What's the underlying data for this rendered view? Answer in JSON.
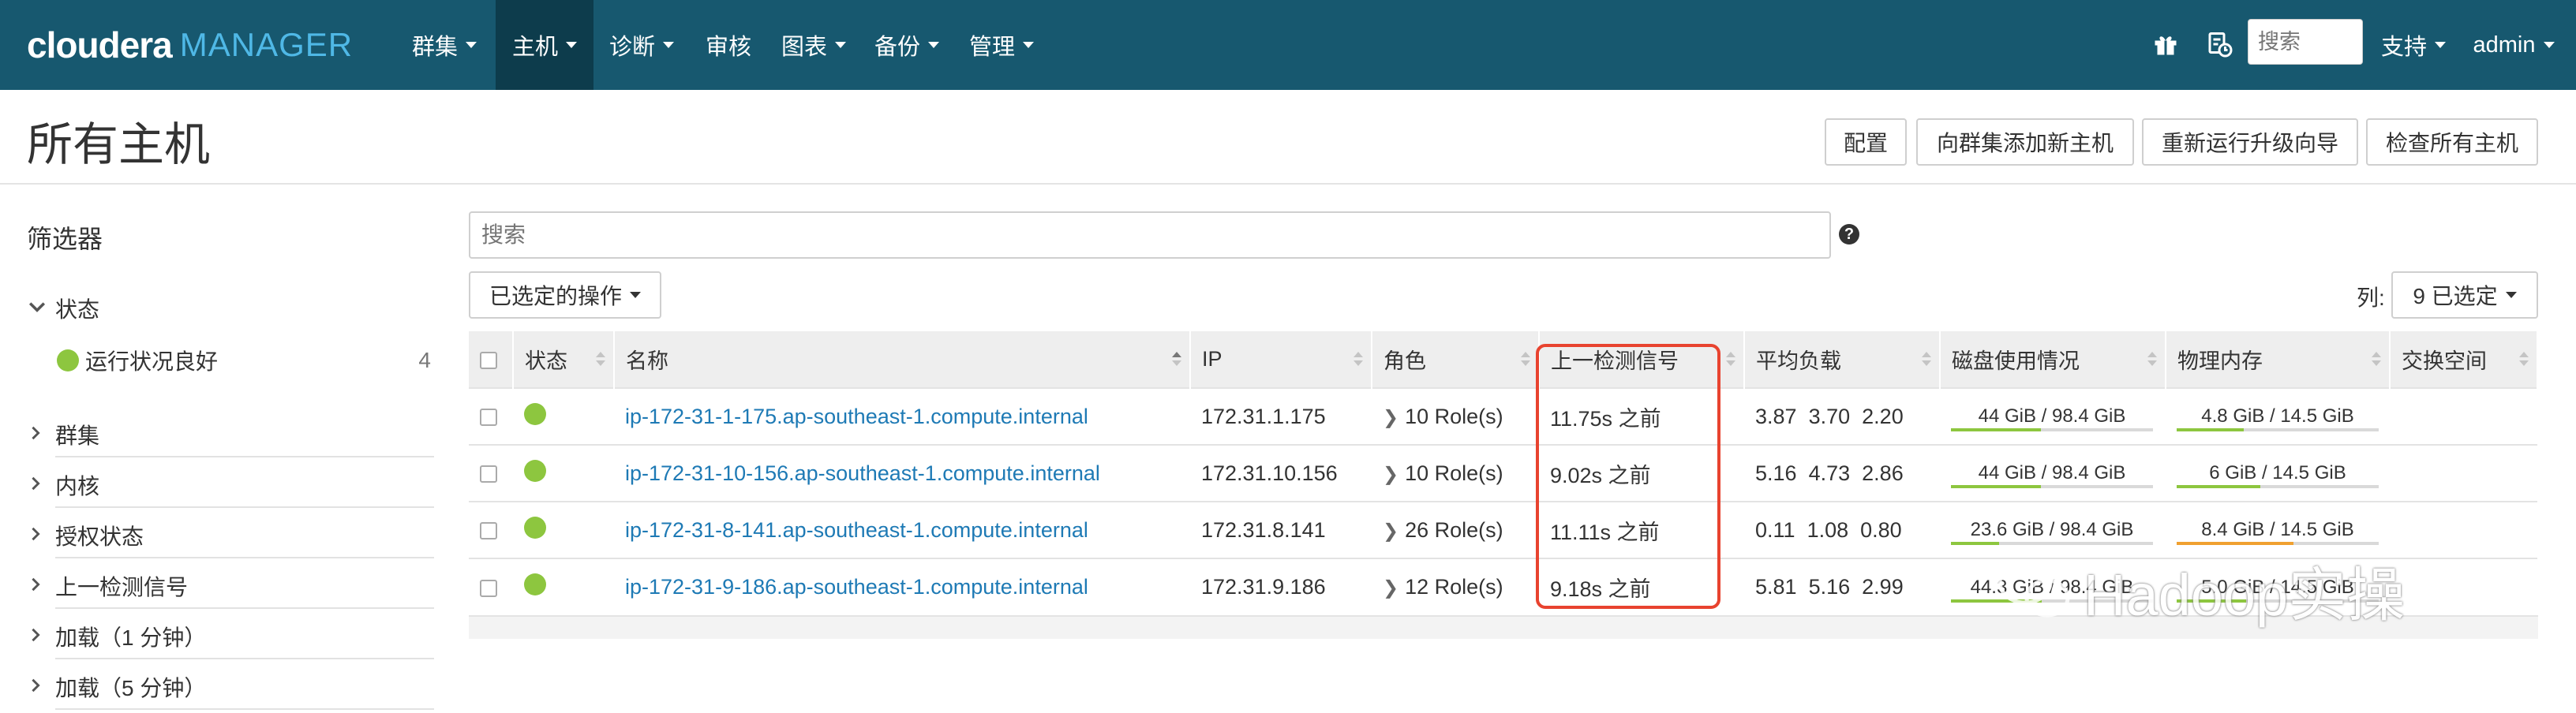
{
  "app": {
    "logo_main": "cloudera",
    "logo_sub": "MANAGER"
  },
  "nav": {
    "items": [
      {
        "label": "群集",
        "dropdown": true
      },
      {
        "label": "主机",
        "dropdown": true,
        "active": true
      },
      {
        "label": "诊断",
        "dropdown": true
      },
      {
        "label": "审核",
        "dropdown": false
      },
      {
        "label": "图表",
        "dropdown": true
      },
      {
        "label": "备份",
        "dropdown": true
      },
      {
        "label": "管理",
        "dropdown": true
      }
    ],
    "search_placeholder": "搜索",
    "support_label": "支持",
    "user_label": "admin"
  },
  "page": {
    "title": "所有主机",
    "buttons": [
      "配置",
      "向群集添加新主机",
      "重新运行升级向导",
      "检查所有主机"
    ]
  },
  "sidebar": {
    "title": "筛选器",
    "status_section": "状态",
    "status_item": {
      "label": "运行状况良好",
      "count": "4"
    },
    "sections": [
      "群集",
      "内核",
      "授权状态",
      "上一检测信号",
      "加载（1 分钟）",
      "加载（5 分钟）"
    ]
  },
  "main": {
    "search_placeholder": "搜索",
    "actions_label": "已选定的操作",
    "columns_label": "列:",
    "columns_value": "9 已选定"
  },
  "table": {
    "headers": [
      "状态",
      "名称",
      "IP",
      "角色",
      "上一检测信号",
      "平均负载",
      "磁盘使用情况",
      "物理内存",
      "交换空间"
    ],
    "rows": [
      {
        "name": "ip-172-31-1-175.ap-southeast-1.compute.internal",
        "ip": "172.31.1.175",
        "roles": "10 Role(s)",
        "heartbeat": "11.75s 之前",
        "load": [
          "3.87",
          "3.70",
          "2.20"
        ],
        "disk": "44 GiB / 98.4 GiB",
        "disk_frac": 0.447,
        "mem": "4.8 GiB / 14.5 GiB",
        "mem_frac": 0.331
      },
      {
        "name": "ip-172-31-10-156.ap-southeast-1.compute.internal",
        "ip": "172.31.10.156",
        "roles": "10 Role(s)",
        "heartbeat": "9.02s 之前",
        "load": [
          "5.16",
          "4.73",
          "2.86"
        ],
        "disk": "44 GiB / 98.4 GiB",
        "disk_frac": 0.447,
        "mem": "6 GiB / 14.5 GiB",
        "mem_frac": 0.414
      },
      {
        "name": "ip-172-31-8-141.ap-southeast-1.compute.internal",
        "ip": "172.31.8.141",
        "roles": "26 Role(s)",
        "heartbeat": "11.11s 之前",
        "load": [
          "0.11",
          "1.08",
          "0.80"
        ],
        "disk": "23.6 GiB / 98.4 GiB",
        "disk_frac": 0.24,
        "mem": "8.4 GiB / 14.5 GiB",
        "mem_frac": 0.579
      },
      {
        "name": "ip-172-31-9-186.ap-southeast-1.compute.internal",
        "ip": "172.31.9.186",
        "roles": "12 Role(s)",
        "heartbeat": "9.18s 之前",
        "load": [
          "5.81",
          "5.16",
          "2.99"
        ],
        "disk": "44.3 GiB / 98.4 GiB",
        "disk_frac": 0.45,
        "mem": "5.0 GiB / 14.5 GiB",
        "mem_frac": 0.345
      }
    ]
  },
  "watermark": "Hadoop实操",
  "colors": {
    "nav_bg": "#17586f",
    "nav_active": "#0d3c4c",
    "good_status": "#8dc63f",
    "link": "#1e7ab5",
    "disk_bar": "#8dc63f",
    "mem_bar": "#8dc63f",
    "mem_bar_warn": "#f0a030",
    "highlight": "#e8432f"
  }
}
